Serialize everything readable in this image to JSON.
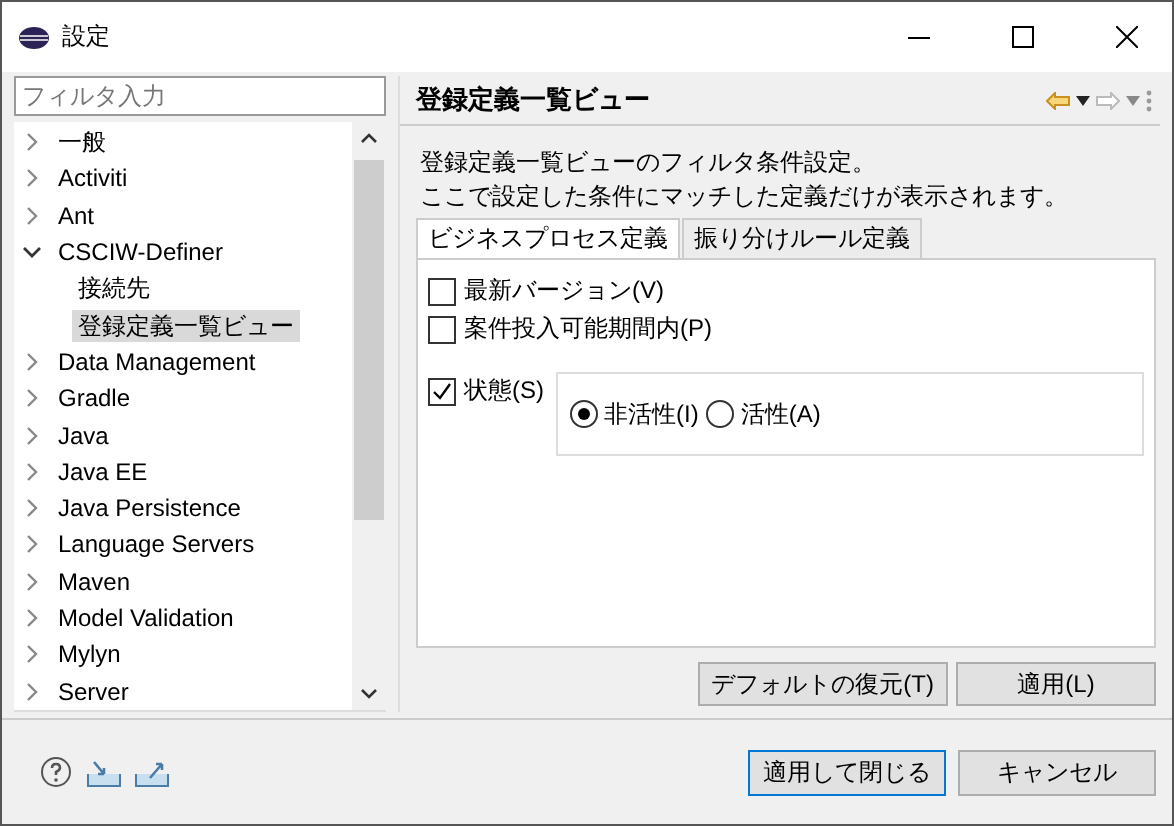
{
  "window": {
    "title": "設定"
  },
  "filter": {
    "placeholder": "フィルタ入力"
  },
  "tree": [
    {
      "label": "一般",
      "expanded": false,
      "selected": false
    },
    {
      "label": "Activiti",
      "expanded": false,
      "selected": false
    },
    {
      "label": "Ant",
      "expanded": false,
      "selected": false
    },
    {
      "label": "CSCIW-Definer",
      "expanded": true,
      "selected": false,
      "children": [
        {
          "label": "接続先",
          "selected": false
        },
        {
          "label": "登録定義一覧ビュー",
          "selected": true
        }
      ]
    },
    {
      "label": "Data Management",
      "expanded": false,
      "selected": false
    },
    {
      "label": "Gradle",
      "expanded": false,
      "selected": false
    },
    {
      "label": "Java",
      "expanded": false,
      "selected": false
    },
    {
      "label": "Java EE",
      "expanded": false,
      "selected": false
    },
    {
      "label": "Java Persistence",
      "expanded": false,
      "selected": false
    },
    {
      "label": "Language Servers",
      "expanded": false,
      "selected": false
    },
    {
      "label": "Maven",
      "expanded": false,
      "selected": false
    },
    {
      "label": "Model Validation",
      "expanded": false,
      "selected": false
    },
    {
      "label": "Mylyn",
      "expanded": false,
      "selected": false
    },
    {
      "label": "Server",
      "expanded": false,
      "selected": false
    }
  ],
  "page": {
    "title": "登録定義一覧ビュー",
    "description": [
      "登録定義一覧ビューのフィルタ条件設定。",
      "ここで設定した条件にマッチした定義だけが表示されます。"
    ],
    "tabs": [
      {
        "label": "ビジネスプロセス定義",
        "selected": true
      },
      {
        "label": "振り分けルール定義",
        "selected": false
      }
    ],
    "checkboxes": [
      {
        "label": "最新バージョン(V)",
        "checked": false
      },
      {
        "label": "案件投入可能期間内(P)",
        "checked": false
      }
    ],
    "state": {
      "label": "状態(S)",
      "checked": true,
      "options": [
        {
          "label": "非活性(I)",
          "selected": true
        },
        {
          "label": "活性(A)",
          "selected": false
        }
      ]
    },
    "buttons": [
      "デフォルトの復元(T)",
      "適用(L)"
    ]
  },
  "footer_buttons": [
    {
      "label": "適用して閉じる",
      "default": true
    },
    {
      "label": "キャンセル",
      "default": false
    }
  ]
}
